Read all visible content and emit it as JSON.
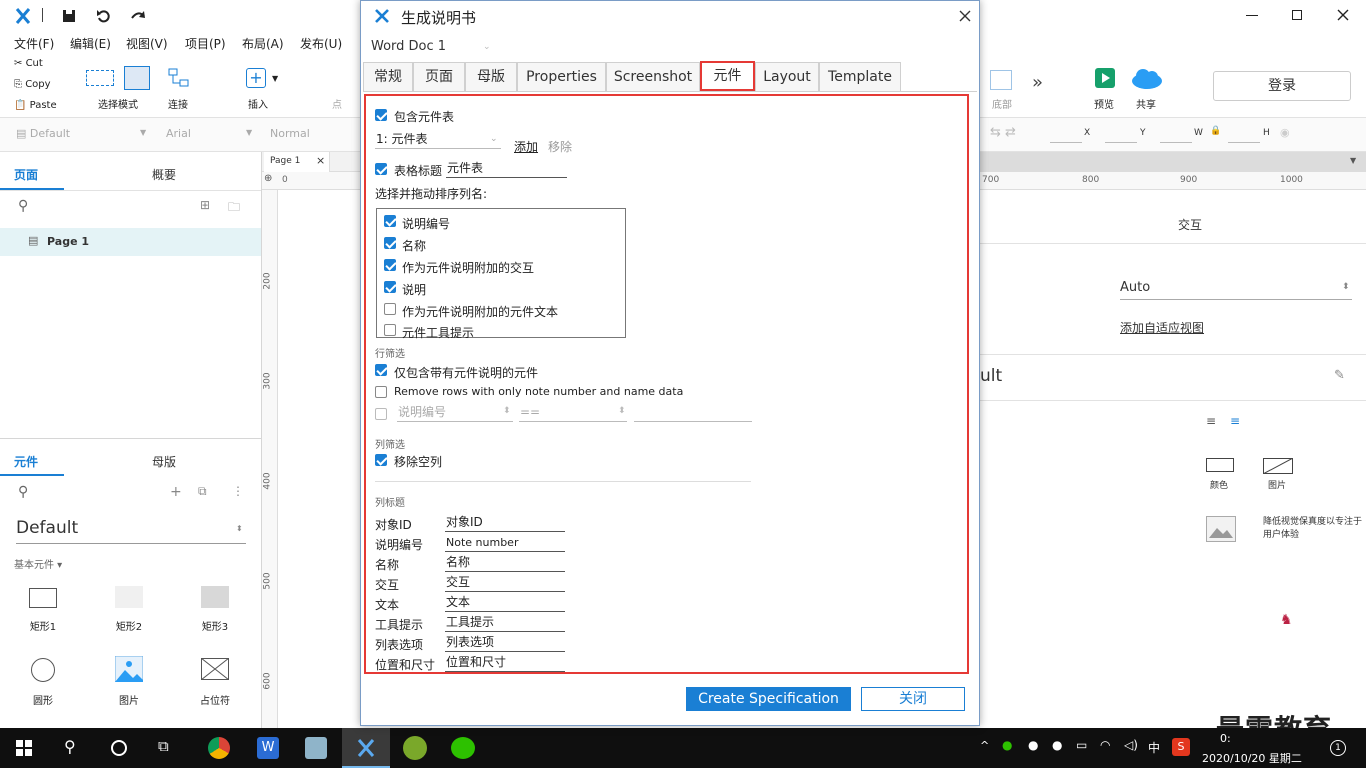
{
  "dialog": {
    "title": "生成说明书",
    "doc_select": "Word Doc 1",
    "tabs": [
      "常规",
      "页面",
      "母版",
      "Properties",
      "Screenshot",
      "元件",
      "Layout",
      "Template"
    ],
    "active_tab": "元件",
    "include_widget_table": "包含元件表",
    "table_select": "1: 元件表",
    "add_link": "添加",
    "remove_link": "移除",
    "table_title_label": "表格标题",
    "table_title_value": "元件表",
    "columns_hint": "选择并拖动排序列名:",
    "columns": [
      {
        "label": "说明编号",
        "checked": true
      },
      {
        "label": "名称",
        "checked": true
      },
      {
        "label": "作为元件说明附加的交互",
        "checked": true
      },
      {
        "label": "说明",
        "checked": true
      },
      {
        "label": "作为元件说明附加的元件文本",
        "checked": false
      },
      {
        "label": "元件工具提示",
        "checked": false
      }
    ],
    "row_filter_heading": "行筛选",
    "only_with_notes": "仅包含带有元件说明的元件",
    "remove_rows": "Remove rows with only note number and name data",
    "filter_field_placeholder": "说明编号",
    "filter_op_placeholder": "==",
    "col_filter_heading": "列筛选",
    "remove_empty_cols": "移除空列",
    "col_headers_heading": "列标题",
    "col_headers": [
      {
        "key": "对象ID",
        "value": "对象ID"
      },
      {
        "key": "说明编号",
        "value": "Note number"
      },
      {
        "key": "名称",
        "value": "名称"
      },
      {
        "key": "交互",
        "value": "交互"
      },
      {
        "key": "文本",
        "value": "文本"
      },
      {
        "key": "工具提示",
        "value": "工具提示"
      },
      {
        "key": "列表选项",
        "value": "列表选项"
      },
      {
        "key": "位置和尺寸",
        "value": "位置和尺寸"
      }
    ],
    "create_button": "Create Specification",
    "close_button": "关闭"
  },
  "menu": [
    "文件(F)",
    "编辑(E)",
    "视图(V)",
    "项目(P)",
    "布局(A)",
    "发布(U)"
  ],
  "toolbar": {
    "cut": "Cut",
    "copy": "Copy",
    "paste": "Paste",
    "select_mode": "选择模式",
    "connect": "连接",
    "insert": "插入",
    "point": "点",
    "bottom": "底部",
    "preview": "预览",
    "share": "共享",
    "login": "登录"
  },
  "stylebar": {
    "style": "Default",
    "font": "Arial",
    "weight": "Normal",
    "x": "X",
    "y": "Y",
    "w": "W",
    "h": "H"
  },
  "left": {
    "tab_pages": "页面",
    "tab_outline": "概要",
    "page1": "Page 1",
    "tab_widgets": "元件",
    "tab_masters": "母版",
    "library": "Default",
    "basic": "基本元件 ▾",
    "shapes": [
      "矩形1",
      "矩形2",
      "矩形3",
      "圆形",
      "图片",
      "占位符"
    ]
  },
  "canvas": {
    "tab": "Page 1",
    "ruler_marks": [
      "200",
      "300",
      "400",
      "500",
      "600"
    ],
    "ruler_zero": "0"
  },
  "right": {
    "ruler_marks": [
      "700",
      "800",
      "900",
      "1000"
    ],
    "interaction": "交互",
    "auto": "Auto",
    "add_adaptive": "添加自适应视图",
    "ult": "ult",
    "fill_color": "颜色",
    "fill_image": "图片",
    "low_fidelity": "降低视觉保真度以专注于用户体验"
  },
  "watermark": "最需教育",
  "taskbar": {
    "ime": "中",
    "datetime": "2020/10/20 星期二",
    "time_partial": "0:",
    "notify": "1"
  },
  "colors": {
    "accent": "#1a7fd4",
    "highlight": "#e53935",
    "taskbar": "#0f0f0f"
  }
}
